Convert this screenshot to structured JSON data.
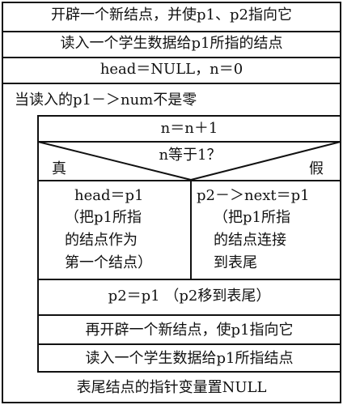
{
  "steps": {
    "s1": "开辟一个新结点，并使p1、p2指向它",
    "s2": "读入一个学生数据给p1所指的结点",
    "s3": "head＝NULL，n＝0",
    "loop": "当读入的p1－＞num不是零",
    "inc": "n＝n＋1",
    "cond": "n等于1？",
    "true_label": "真",
    "false_label": "假",
    "yes_stmt": "head＝p1",
    "yes_note": [
      "（把p1所指",
      "的结点作为",
      "第一个结点）"
    ],
    "no_stmt": "p2－＞next＝p1",
    "no_note": [
      "（把p1所指",
      "的结点连接",
      "到表尾"
    ],
    "move": "p2＝p1 （p2移到表尾）",
    "new": "再开辟一个新结点，使p1指向它",
    "read": "读入一个学生数据给p1所指结点",
    "last": "表尾结点的指针变量置NULL"
  }
}
